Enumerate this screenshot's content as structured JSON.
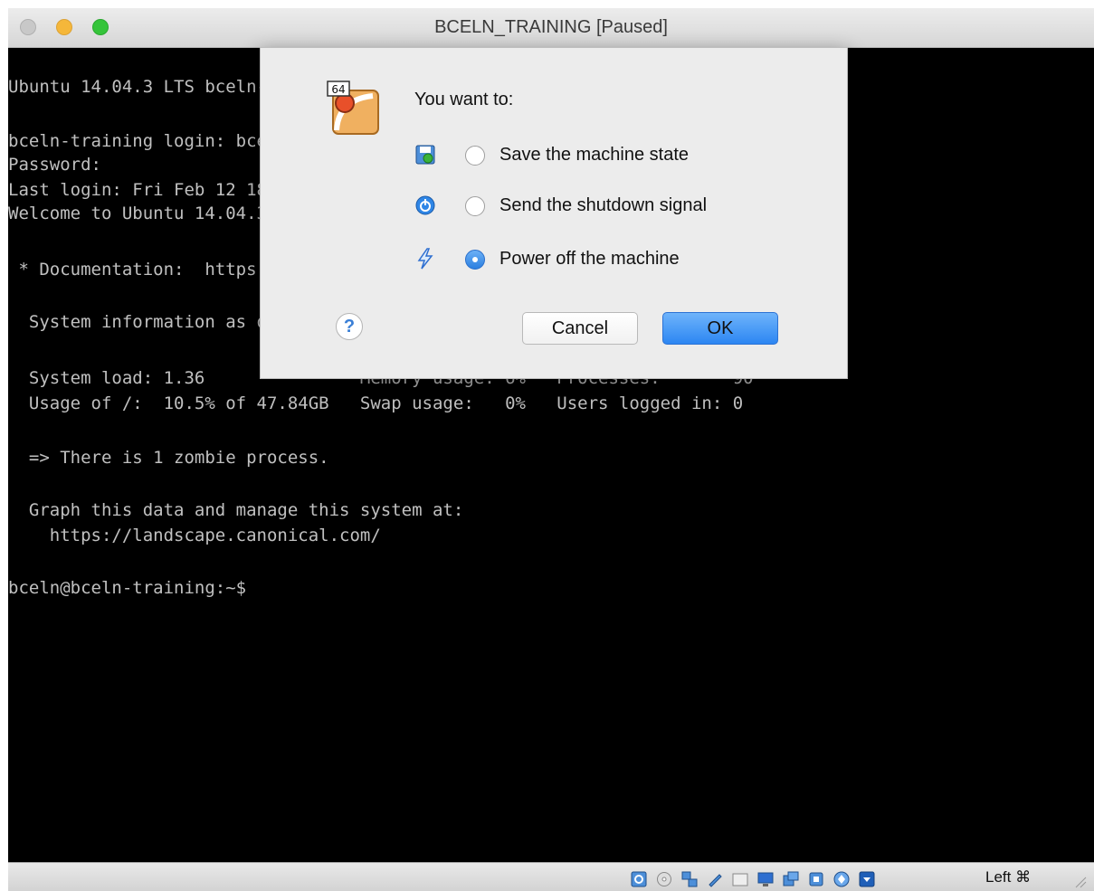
{
  "window": {
    "title": "BCELN_TRAINING [Paused]"
  },
  "terminal": {
    "lines": [
      "Ubuntu 14.04.3 LTS bceln-training tty1",
      "",
      "bceln-training login: bceln",
      "Password:",
      "Last login: Fri Feb 12 18:12:29 AST 2016 on tty1",
      "Welcome to Ubuntu 14.04.3 LTS (GNU/Linux 3.19.0-25-generic x86_64)",
      "",
      " * Documentation:  https://help.ubuntu.com/",
      "",
      "  System information as of Fri Feb 12 18:21:06 AST 2016",
      "",
      "  System load: 1.36               Memory usage: 6%   Processes:       90",
      "  Usage of /:  10.5% of 47.84GB   Swap usage:   0%   Users logged in: 0",
      "",
      "  => There is 1 zombie process.",
      "",
      "  Graph this data and manage this system at:",
      "    https://landscape.canonical.com/",
      "",
      "bceln@bceln-training:~$"
    ]
  },
  "dialog": {
    "prompt": "You want to:",
    "app_icon": "virtualbox-64-icon",
    "options": [
      {
        "label": "Save the machine state",
        "icon": "save-state-icon",
        "checked": false
      },
      {
        "label": "Send the shutdown signal",
        "icon": "acpi-shutdown-icon",
        "checked": false
      },
      {
        "label": "Power off the machine",
        "icon": "power-off-icon",
        "checked": true
      }
    ],
    "help_label": "?",
    "cancel_label": "Cancel",
    "ok_label": "OK"
  },
  "statusbar": {
    "icons": [
      "hard-disk-icon",
      "optical-drive-icon",
      "network-icon",
      "usb-icon",
      "shared-folders-icon",
      "display-icon",
      "video-capture-icon",
      "cpu-icon",
      "mouse-integration-icon",
      "keyboard-capture-icon"
    ],
    "host_key": "Left ⌘"
  },
  "colors": {
    "accent": "#2c86f2",
    "terminal_bg": "#000000",
    "terminal_fg": "#c0c0c0"
  }
}
